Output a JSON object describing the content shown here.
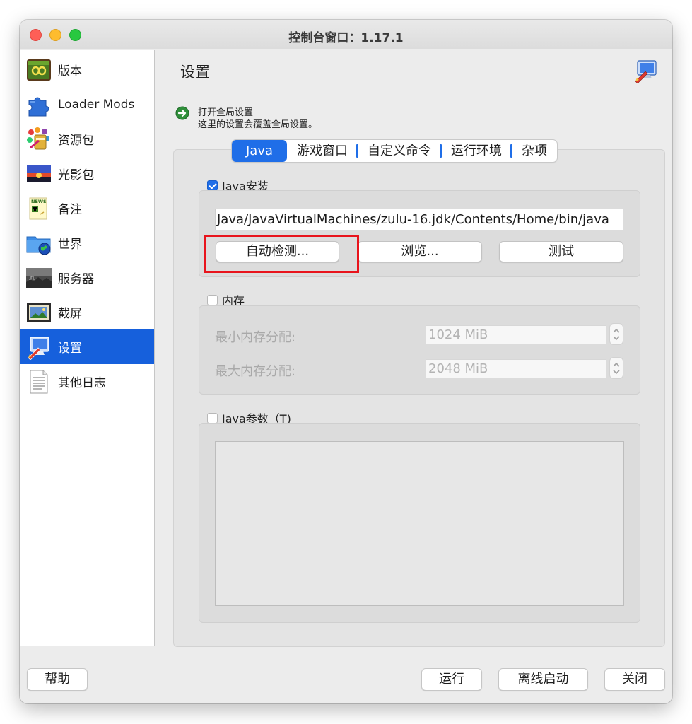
{
  "window": {
    "title": "控制台窗口：1.17.1"
  },
  "sidebar": {
    "items": [
      {
        "label": "版本",
        "icon": "version-infinity-icon"
      },
      {
        "label": "Loader Mods",
        "icon": "puzzle-piece-icon"
      },
      {
        "label": "资源包",
        "icon": "paint-palette-icon"
      },
      {
        "label": "光影包",
        "icon": "sunset-image-icon"
      },
      {
        "label": "备注",
        "icon": "news-note-icon"
      },
      {
        "label": "世界",
        "icon": "folder-globe-icon"
      },
      {
        "label": "服务器",
        "icon": "server-landscape-icon"
      },
      {
        "label": "截屏",
        "icon": "picture-frame-icon"
      },
      {
        "label": "设置",
        "icon": "settings-pen-monitor-icon",
        "active": true
      },
      {
        "label": "其他日志",
        "icon": "log-document-icon"
      }
    ]
  },
  "content": {
    "title": "设置",
    "global_line1": "打开全局设置",
    "global_line2": "这里的设置会覆盖全局设置。"
  },
  "tabs": [
    {
      "label": "Java",
      "active": true
    },
    {
      "label": "游戏窗口"
    },
    {
      "label": "自定义命令"
    },
    {
      "label": "运行环境"
    },
    {
      "label": "杂项"
    }
  ],
  "java_install": {
    "label": "Java安装",
    "checked": true,
    "path": "Java/JavaVirtualMachines/zulu-16.jdk/Contents/Home/bin/java",
    "detect_label": "自动检测...",
    "browse_label": "浏览...",
    "test_label": "测试"
  },
  "memory": {
    "label": "内存",
    "checked": false,
    "min_label": "最小内存分配:",
    "min_value": "1024 MiB",
    "max_label": "最大内存分配:",
    "max_value": "2048 MiB"
  },
  "java_args": {
    "label": "Java参数（T)",
    "checked": false,
    "value": ""
  },
  "footer": {
    "help_label": "帮助",
    "run_label": "运行",
    "offline_label": "离线启动",
    "close_label": "关闭"
  },
  "colors": {
    "accent": "#1f6ee8",
    "sidebar_active": "#1660dc",
    "highlight_box": "#e8141c"
  }
}
